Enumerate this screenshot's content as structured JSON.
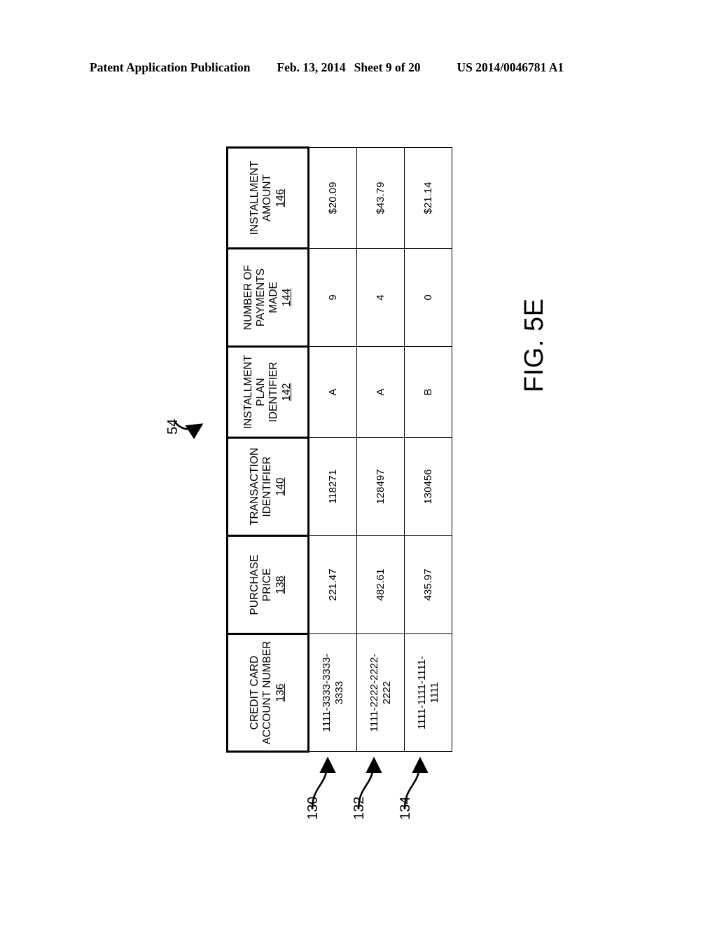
{
  "header": {
    "publication": "Patent Application Publication",
    "date": "Feb. 13, 2014",
    "sheet": "Sheet 9 of 20",
    "document_number": "US 2014/0046781 A1"
  },
  "figure": {
    "caption": "FIG. 5E",
    "table_reference": "54",
    "row_references": [
      "130",
      "132",
      "134"
    ]
  },
  "table": {
    "columns": [
      {
        "label_line1": "CREDIT CARD",
        "label_line2": "ACCOUNT NUMBER",
        "label_line3": "",
        "ref": "136"
      },
      {
        "label_line1": "PURCHASE",
        "label_line2": "PRICE",
        "label_line3": "",
        "ref": "138"
      },
      {
        "label_line1": "TRANSACTION",
        "label_line2": "IDENTIFIER",
        "label_line3": "",
        "ref": "140"
      },
      {
        "label_line1": "INSTALLMENT",
        "label_line2": "PLAN",
        "label_line3": "IDENTIFIER",
        "ref": "142"
      },
      {
        "label_line1": "NUMBER OF",
        "label_line2": "PAYMENTS",
        "label_line3": "MADE",
        "ref": "144"
      },
      {
        "label_line1": "INSTALLMENT",
        "label_line2": "AMOUNT",
        "label_line3": "",
        "ref": "146"
      }
    ],
    "rows": [
      {
        "ref": "130",
        "credit_card_account_number": "1111-3333-3333-\n3333",
        "purchase_price": "221.47",
        "transaction_identifier": "118271",
        "installment_plan_identifier": "A",
        "number_of_payments_made": "9",
        "installment_amount": "$20.09"
      },
      {
        "ref": "132",
        "credit_card_account_number": "1111-2222-2222-\n2222",
        "purchase_price": "482.61",
        "transaction_identifier": "128497",
        "installment_plan_identifier": "A",
        "number_of_payments_made": "4",
        "installment_amount": "$43.79"
      },
      {
        "ref": "134",
        "credit_card_account_number": "1111-1111-1111-\n1111",
        "purchase_price": "435.97",
        "transaction_identifier": "130456",
        "installment_plan_identifier": "B",
        "number_of_payments_made": "0",
        "installment_amount": "$21.14"
      }
    ]
  },
  "colors": {
    "ink": "#000000",
    "paper": "#ffffff"
  }
}
